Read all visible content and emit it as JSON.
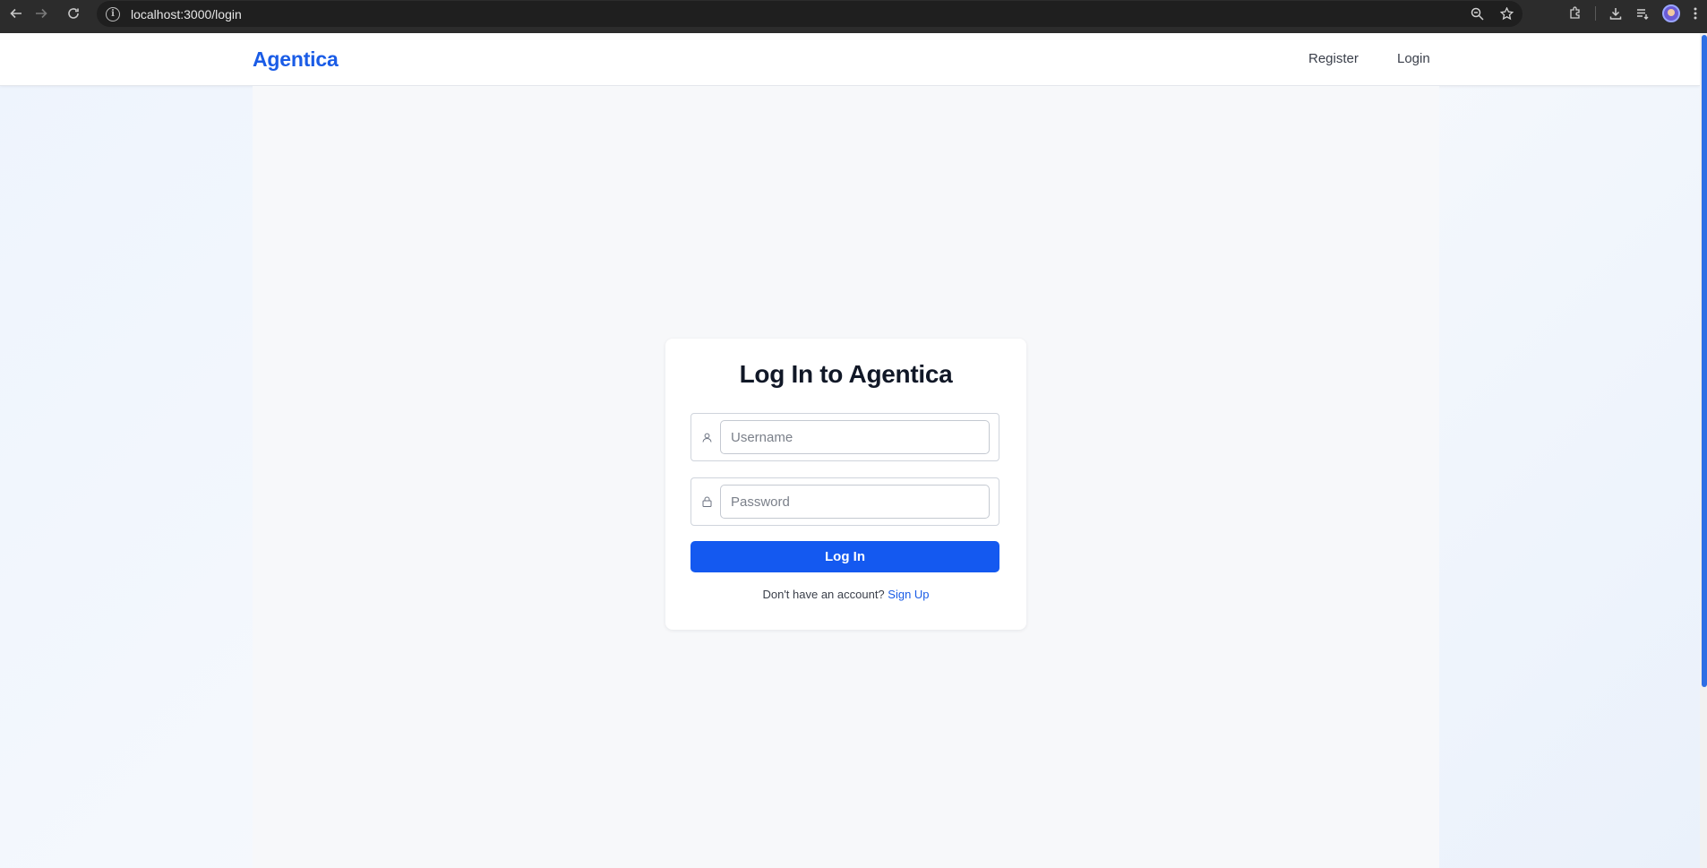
{
  "browser": {
    "url": "localhost:3000/login"
  },
  "header": {
    "logo": "Agentica",
    "nav": {
      "register": "Register",
      "login": "Login"
    }
  },
  "login_card": {
    "title": "Log In to Agentica",
    "username_placeholder": "Username",
    "password_placeholder": "Password",
    "submit_label": "Log In",
    "signup_prompt": "Don't have an account?",
    "signup_link": "Sign Up"
  },
  "colors": {
    "brand": "#1a5ce6",
    "button": "#1459f0",
    "scrollbar_thumb": "#2f6fe4"
  }
}
